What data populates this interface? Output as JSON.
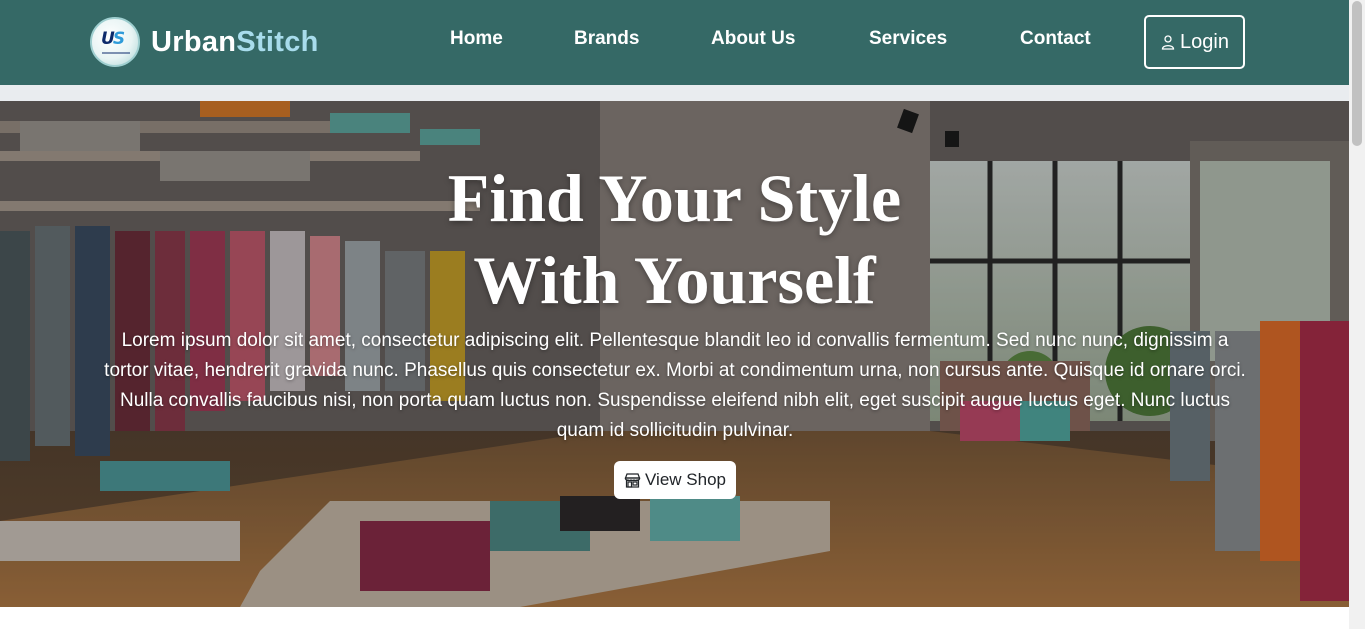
{
  "brand": {
    "logo_letters_a": "U",
    "logo_letters_b": "S",
    "name_part1": "Urban",
    "name_part2": "Stitch"
  },
  "nav": {
    "items": [
      {
        "label": "Home"
      },
      {
        "label": "Brands"
      },
      {
        "label": "About Us"
      },
      {
        "label": "Services"
      },
      {
        "label": "Contact"
      }
    ],
    "login_label": "Login"
  },
  "hero": {
    "title_line1": "Find Your Style",
    "title_line2": "With Yourself",
    "text": "Lorem ipsum dolor sit amet, consectetur adipiscing elit. Pellentesque blandit leo id convallis fermentum. Sed nunc nunc, dignissim a tortor vitae, hendrerit gravida nunc. Phasellus quis consectetur ex. Morbi at condimentum urna, non cursus ante. Quisque id ornare orci. Nulla convallis faucibus nisi, non porta quam luctus non. Suspendisse eleifend nibh elit, eget suscipit augue luctus eget. Nunc luctus quam id sollicitudin pulvinar.",
    "button_label": "View Shop"
  },
  "colors": {
    "navbar": "#356966",
    "brand_accent": "#a8dcec",
    "strip": "#e9ecef"
  },
  "icons": {
    "login": "person-icon",
    "shop": "shop-icon"
  }
}
